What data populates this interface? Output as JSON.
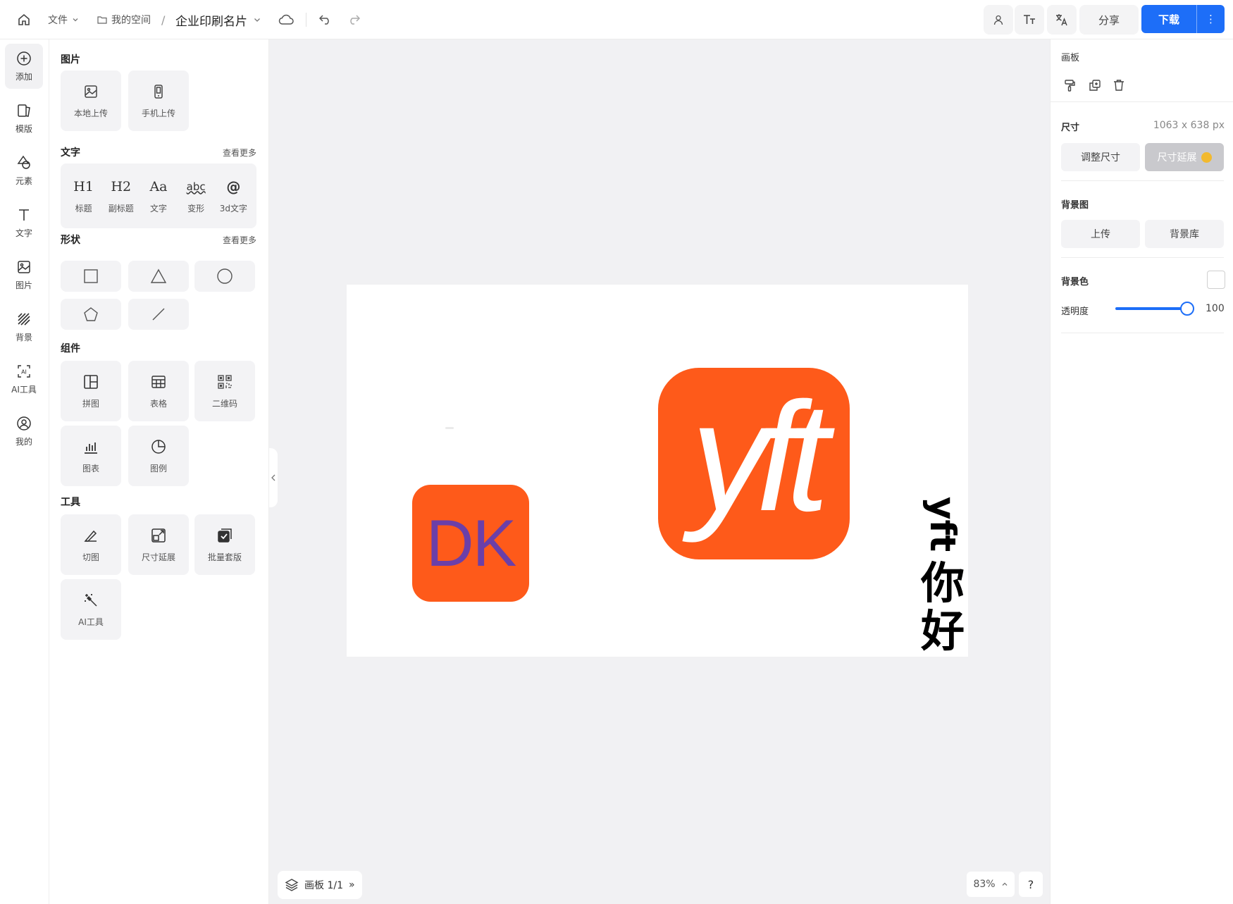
{
  "topbar": {
    "file_label": "文件",
    "breadcrumb": "我的空间",
    "separator": "/",
    "doc_title": "企业印刷名片",
    "share_label": "分享",
    "download_label": "下载",
    "more_label": "⋮"
  },
  "rail": [
    {
      "label": "添加",
      "icon": "plus-circle-icon"
    },
    {
      "label": "模版",
      "icon": "template-icon"
    },
    {
      "label": "元素",
      "icon": "shapes-icon"
    },
    {
      "label": "文字",
      "icon": "text-icon"
    },
    {
      "label": "图片",
      "icon": "image-icon"
    },
    {
      "label": "背景",
      "icon": "pattern-icon"
    },
    {
      "label": "AI工具",
      "icon": "ai-icon"
    },
    {
      "label": "我的",
      "icon": "user-circle-icon"
    }
  ],
  "panel": {
    "images": {
      "title": "图片",
      "local_upload": "本地上传",
      "mobile_upload": "手机上传"
    },
    "text": {
      "title": "文字",
      "more": "查看更多",
      "options": [
        {
          "glyph": "H1",
          "label": "标题"
        },
        {
          "glyph": "H2",
          "label": "副标题"
        },
        {
          "glyph": "Aa",
          "label": "文字"
        },
        {
          "glyph": "abc",
          "label": "变形"
        },
        {
          "glyph": "@",
          "label": "3d文字"
        }
      ]
    },
    "shapes": {
      "title": "形状",
      "more": "查看更多"
    },
    "components": {
      "title": "组件",
      "collage": "拼图",
      "table": "表格",
      "qrcode": "二维码",
      "chart": "图表",
      "legend": "图例"
    },
    "tools": {
      "title": "工具",
      "crop": "切图",
      "resize": "尺寸延展",
      "batch": "批量套版",
      "ai": "AI工具"
    }
  },
  "canvas": {
    "dk_text": "DK",
    "yft_text": "yft",
    "vertical_rotated": "yft",
    "vertical_chars": [
      "你",
      "好"
    ],
    "layer_label": "画板 1/1",
    "layer_expand": "»",
    "zoom": "83%",
    "help": "?"
  },
  "right_panel": {
    "artboard_title": "画板",
    "size_label": "尺寸",
    "size_value": "1063 x 638 px",
    "resize_btn": "调整尺寸",
    "extend_btn": "尺寸延展",
    "bg_image_label": "背景图",
    "upload_btn": "上传",
    "library_btn": "背景库",
    "bg_color_label": "背景色",
    "opacity_label": "透明度",
    "opacity_value": "100"
  },
  "colors": {
    "accent": "#1d6ef8",
    "logo_orange": "#fe5a1a",
    "dk_purple": "#6b3fa8"
  }
}
